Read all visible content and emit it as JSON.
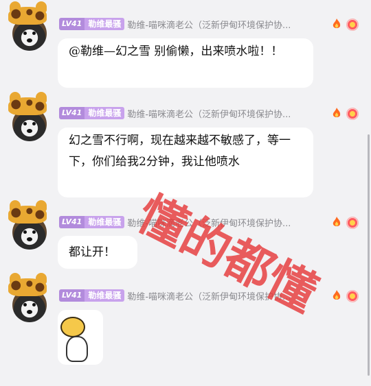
{
  "messages": [
    {
      "level": "LV41",
      "title": "勒维最骚",
      "nickname": "勒维-喵咪滴老公（泛新伊甸环境保护协...",
      "text": "@勒维—幻之雪 别偷懒，出来喷水啦！！"
    },
    {
      "level": "LV41",
      "title": "勒维最骚",
      "nickname": "勒维-喵咪滴老公（泛新伊甸环境保护协...",
      "text": "幻之雪不行啊，现在越来越不敏感了，等一下，你们给我2分钟，我让他喷水"
    },
    {
      "level": "LV41",
      "title": "勒维最骚",
      "nickname": "勒维-喵咪滴老公（泛新伊甸环境保护协...",
      "text": "都让开！"
    },
    {
      "level": "LV41",
      "title": "勒维最骚",
      "nickname": "勒维-喵咪滴老公（泛新伊甸环境保护协..."
    }
  ],
  "watermark": "懂的都懂",
  "colors": {
    "level_badge": "#b28bdc",
    "title_badge": "#c8a2ec",
    "watermark": "#e63b3b"
  }
}
